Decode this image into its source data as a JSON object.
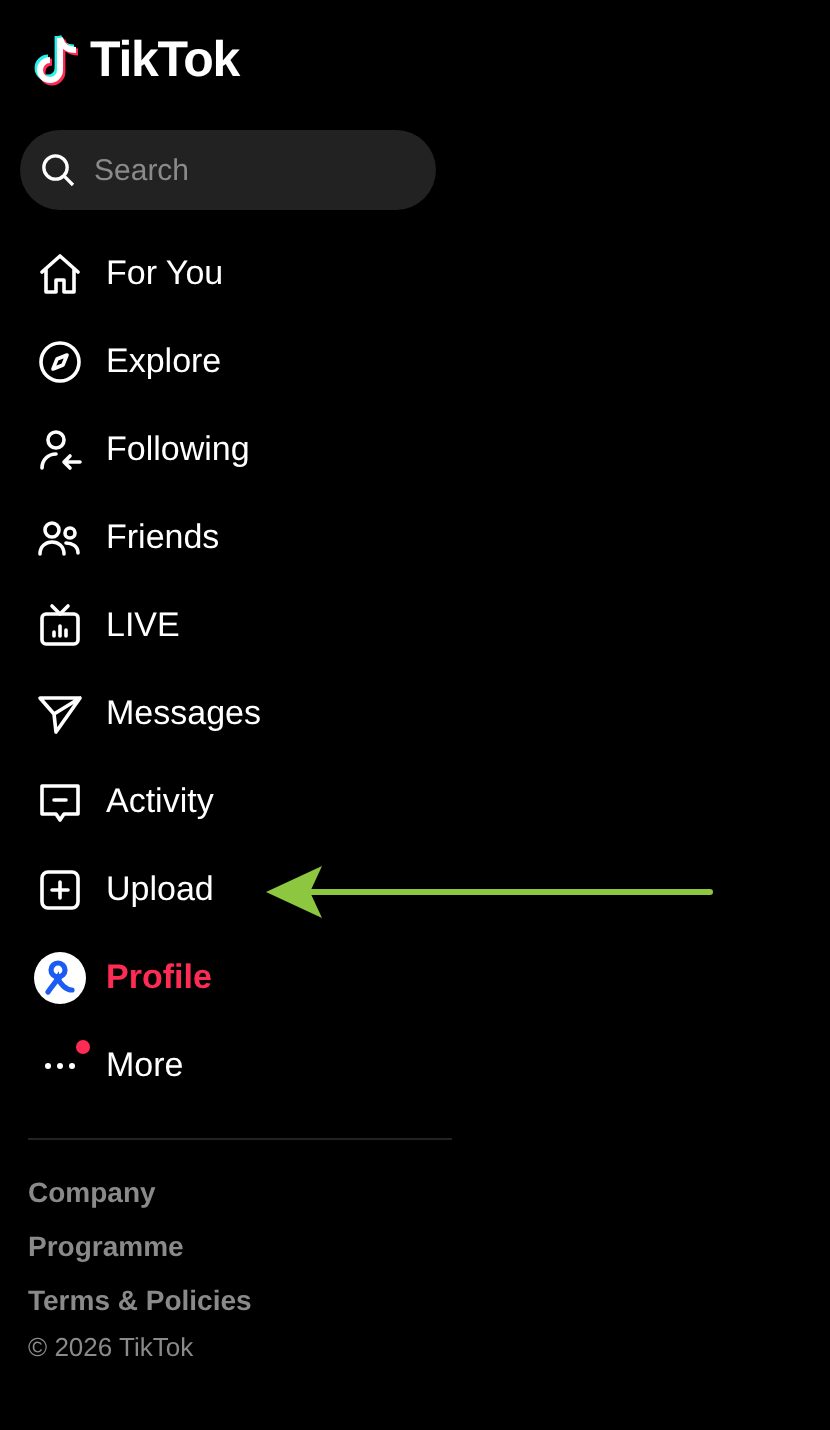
{
  "logo": {
    "text": "TikTok"
  },
  "search": {
    "placeholder": "Search"
  },
  "nav": [
    {
      "kind": "home",
      "label": "For You",
      "selected": false,
      "badge": false
    },
    {
      "kind": "compass",
      "label": "Explore",
      "selected": false,
      "badge": false
    },
    {
      "kind": "following",
      "label": "Following",
      "selected": false,
      "badge": false
    },
    {
      "kind": "friends",
      "label": "Friends",
      "selected": false,
      "badge": false
    },
    {
      "kind": "live",
      "label": "LIVE",
      "selected": false,
      "badge": false
    },
    {
      "kind": "messages",
      "label": "Messages",
      "selected": false,
      "badge": false
    },
    {
      "kind": "activity",
      "label": "Activity",
      "selected": false,
      "badge": false
    },
    {
      "kind": "upload",
      "label": "Upload",
      "selected": false,
      "badge": false
    },
    {
      "kind": "avatar",
      "label": "Profile",
      "selected": true,
      "badge": false
    },
    {
      "kind": "more",
      "label": "More",
      "selected": false,
      "badge": true
    }
  ],
  "footer_links": [
    "Company",
    "Programme",
    "Terms & Policies"
  ],
  "copyright": "© 2026 TikTok"
}
